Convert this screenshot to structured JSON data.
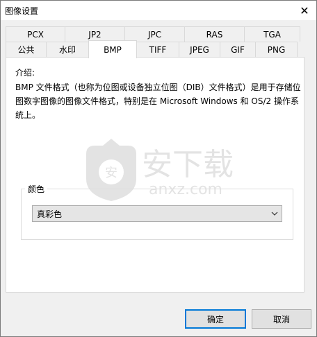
{
  "window": {
    "title": "图像设置",
    "close_symbol": "✕"
  },
  "tabs": {
    "row1": [
      "PCX",
      "JP2",
      "JPC",
      "RAS",
      "TGA"
    ],
    "row2": [
      "公共",
      "水印",
      "BMP",
      "TIFF",
      "JPEG",
      "GIF",
      "PNG"
    ],
    "active": "BMP"
  },
  "panel": {
    "intro_label": "介绍:",
    "intro_text": "BMP 文件格式（也称为位图或设备独立位图（DIB）文件格式）是用于存储位图数字图像的图像文件格式，特别是在 Microsoft Windows 和 OS/2 操作系统上。",
    "color_group_label": "颜色",
    "color_select_value": "真彩色"
  },
  "watermark": {
    "text_cn": "安下载",
    "text_en": "anxz.com"
  },
  "buttons": {
    "ok": "确定",
    "cancel": "取消"
  },
  "icons": {
    "close": "close-icon",
    "dropdown": "chevron-down-icon",
    "watermark_logo": "shield-logo-icon"
  }
}
